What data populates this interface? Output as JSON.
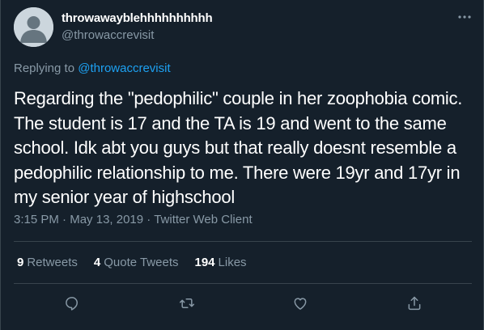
{
  "user": {
    "display_name": "throwawayblehhhhhhhhhh",
    "handle": "@throwaccrevisit"
  },
  "reply": {
    "prefix": "Replying to ",
    "mention": "@throwaccrevisit"
  },
  "tweet": {
    "text": "Regarding the \"pedophilic\" couple in her zoophobia comic. The student is 17 and the TA is 19 and went to the same school. Idk abt you guys but that really doesnt resemble a pedophilic relationship to me. There were 19yr and 17yr in my senior year of highschool",
    "time": "3:15 PM",
    "sep1": " · ",
    "date": "May 13, 2019",
    "sep2": " · ",
    "client": "Twitter Web Client"
  },
  "stats": {
    "retweets_count": "9",
    "retweets_label": "Retweets",
    "quotes_count": "4",
    "quotes_label": "Quote Tweets",
    "likes_count": "194",
    "likes_label": "Likes"
  },
  "icons": {
    "more": "more-horizontal-icon",
    "reply": "reply-icon",
    "retweet": "retweet-icon",
    "like": "heart-icon",
    "share": "share-icon"
  },
  "colors": {
    "background": "#15202b",
    "secondary_text": "#8899a6",
    "accent": "#1da1f2",
    "divider": "#38444d"
  }
}
